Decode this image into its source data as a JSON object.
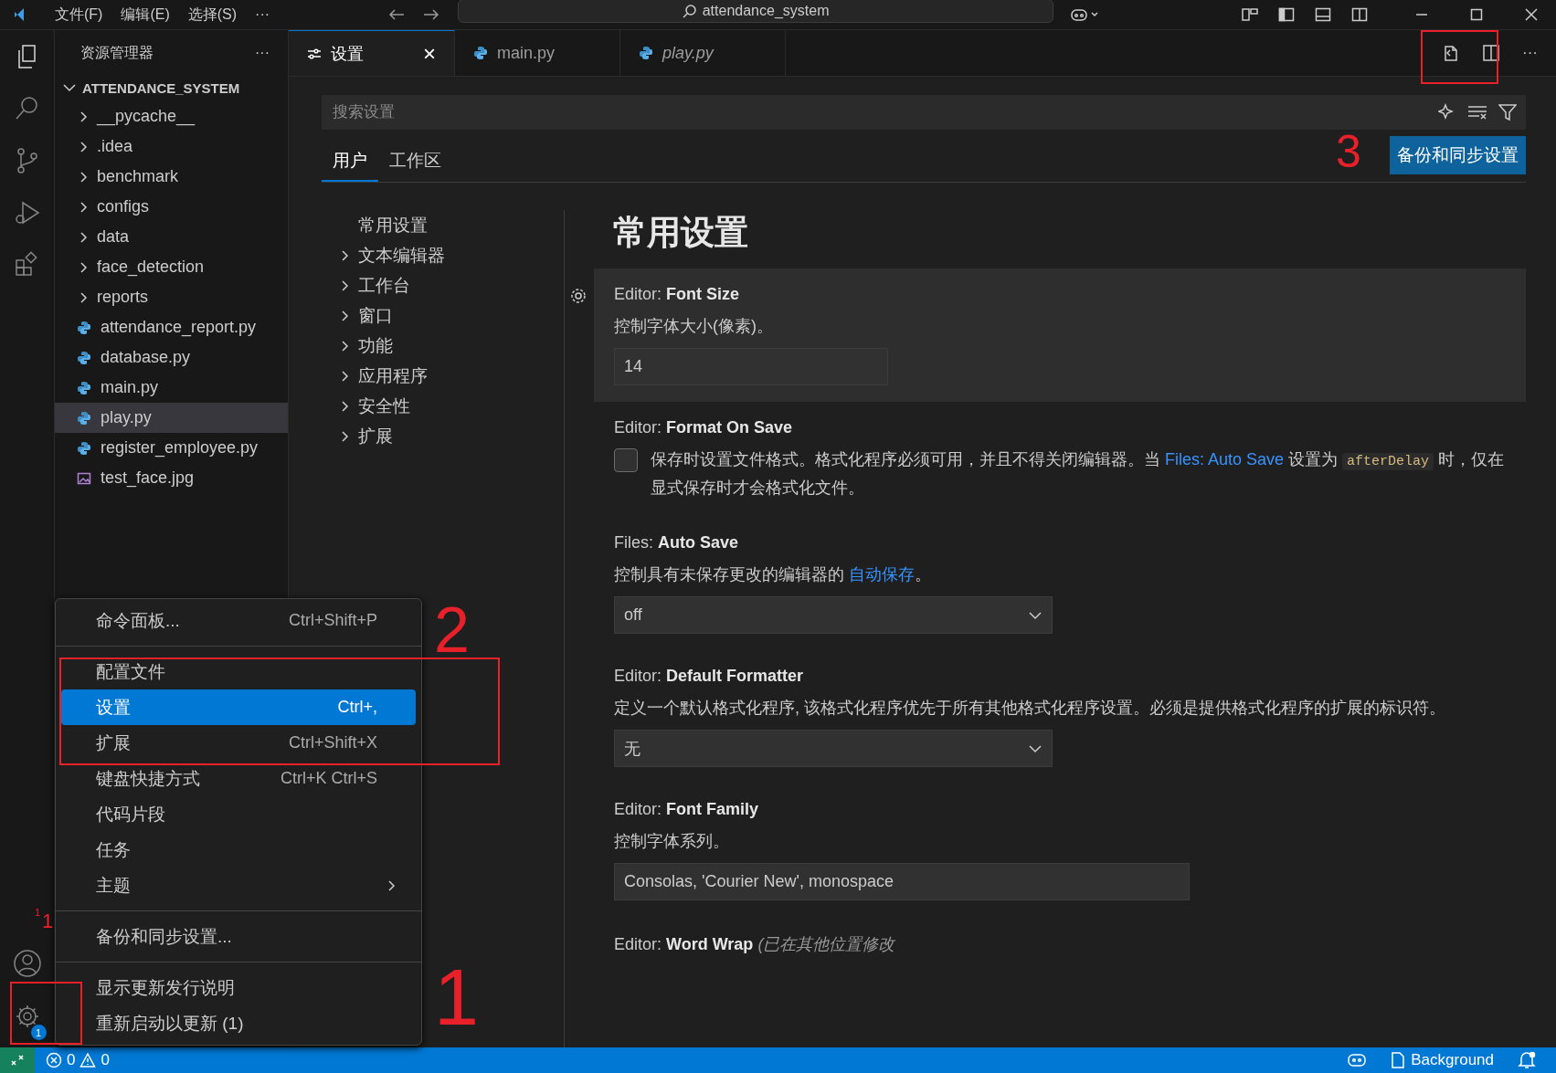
{
  "title_bar": {
    "menus": [
      "文件(F)",
      "编辑(E)",
      "选择(S)",
      "···"
    ],
    "search": "attendance_system"
  },
  "activity_bar": {
    "items": [
      {
        "selected": true
      },
      {
        "selected": false
      },
      {
        "selected": false
      },
      {
        "selected": false
      },
      {
        "selected": false
      }
    ],
    "manage_badge": "1"
  },
  "sidebar": {
    "title": "资源管理器",
    "more": "···",
    "folder": {
      "name": "ATTENDANCE_SYSTEM",
      "expanded": true,
      "children": [
        {
          "name": "__pycache__",
          "kind": "folder",
          "expanded": false,
          "selected": false
        },
        {
          "name": ".idea",
          "kind": "folder",
          "expanded": false,
          "selected": false
        },
        {
          "name": "benchmark",
          "kind": "folder",
          "expanded": false,
          "selected": false
        },
        {
          "name": "configs",
          "kind": "folder",
          "expanded": false,
          "selected": false
        },
        {
          "name": "data",
          "kind": "folder",
          "expanded": false,
          "selected": false
        },
        {
          "name": "face_detection",
          "kind": "folder",
          "expanded": false,
          "selected": false
        },
        {
          "name": "reports",
          "kind": "folder",
          "expanded": false,
          "selected": false
        },
        {
          "name": "attendance_report.py",
          "kind": "python",
          "selected": false
        },
        {
          "name": "database.py",
          "kind": "python",
          "selected": false
        },
        {
          "name": "main.py",
          "kind": "python",
          "selected": false
        },
        {
          "name": "play.py",
          "kind": "python",
          "selected": true
        },
        {
          "name": "register_employee.py",
          "kind": "python",
          "selected": false
        },
        {
          "name": "test_face.jpg",
          "kind": "image",
          "selected": false
        }
      ]
    }
  },
  "editor_actions": {
    "more": "···"
  },
  "tabs": [
    {
      "label": "设置",
      "kind": "settings",
      "selected": true,
      "preview": false,
      "close": "×"
    },
    {
      "label": "main.py",
      "kind": "python",
      "selected": false,
      "preview": false
    },
    {
      "label": "play.py",
      "kind": "python",
      "selected": false,
      "preview": true
    }
  ],
  "settings": {
    "search_placeholder": "搜索设置",
    "scopes": [
      {
        "label": "用户",
        "selected": true
      },
      {
        "label": "工作区",
        "selected": false
      }
    ],
    "sync_button": "备份和同步设置",
    "toc": [
      {
        "label": "常用设置",
        "expandable": false
      },
      {
        "label": "文本编辑器",
        "expandable": true
      },
      {
        "label": "工作台",
        "expandable": true
      },
      {
        "label": "窗口",
        "expandable": true
      },
      {
        "label": "功能",
        "expandable": true
      },
      {
        "label": "应用程序",
        "expandable": true
      },
      {
        "label": "安全性",
        "expandable": true
      },
      {
        "label": "扩展",
        "expandable": true
      }
    ],
    "heading": "常用设置",
    "items": [
      {
        "kind": "number",
        "category": "Editor: ",
        "title": "Font Size",
        "focused": true,
        "description": [
          {
            "kind": "text",
            "text": "控制字体大小(像素)。"
          }
        ],
        "value": "14"
      },
      {
        "kind": "checkbox",
        "category": "Editor: ",
        "title": "Format On Save",
        "focused": false,
        "checked": false,
        "description": [
          {
            "kind": "text",
            "text": "保存时设置文件格式。格式化程序必须可用，并且不得关闭编辑器。当 "
          },
          {
            "kind": "link",
            "text": "Files: Auto Save"
          },
          {
            "kind": "text",
            "text": " 设置为 "
          },
          {
            "kind": "code",
            "text": "afterDelay"
          },
          {
            "kind": "text",
            "text": " 时，仅在显式保存时才会格式化文件。"
          }
        ]
      },
      {
        "kind": "select",
        "category": "Files: ",
        "title": "Auto Save",
        "focused": false,
        "description": [
          {
            "kind": "text",
            "text": "控制具有未保存更改的编辑器的 "
          },
          {
            "kind": "link",
            "text": "自动保存"
          },
          {
            "kind": "text",
            "text": "。"
          }
        ],
        "value": "off"
      },
      {
        "kind": "select",
        "category": "Editor: ",
        "title": "Default Formatter",
        "focused": false,
        "description": [
          {
            "kind": "text",
            "text": "定义一个默认格式化程序, 该格式化程序优先于所有其他格式化程序设置。必须是提供格式化程序的扩展的标识符。"
          }
        ],
        "value": "无"
      },
      {
        "kind": "text",
        "category": "Editor: ",
        "title": "Font Family",
        "focused": false,
        "description": [
          {
            "kind": "text",
            "text": "控制字体系列。"
          }
        ],
        "value": "Consolas, 'Courier New', monospace"
      },
      {
        "kind": "header",
        "category": "Editor: ",
        "title": "Word Wrap",
        "focused": false,
        "note": "(已在其他位置修改"
      }
    ]
  },
  "menu": {
    "groups": [
      [
        {
          "label": "命令面板...",
          "shortcut": "Ctrl+Shift+P",
          "selected": false,
          "submenu": false
        }
      ],
      [
        {
          "label": "配置文件",
          "selected": false,
          "submenu": false
        },
        {
          "label": "设置",
          "shortcut": "Ctrl+,",
          "selected": true,
          "submenu": false
        },
        {
          "label": "扩展",
          "shortcut": "Ctrl+Shift+X",
          "selected": false,
          "submenu": false
        },
        {
          "label": "键盘快捷方式",
          "shortcut": "Ctrl+K Ctrl+S",
          "selected": false,
          "submenu": false
        },
        {
          "label": "代码片段",
          "selected": false,
          "submenu": false
        },
        {
          "label": "任务",
          "selected": false,
          "submenu": false
        },
        {
          "label": "主题",
          "selected": false,
          "submenu": true
        }
      ],
      [
        {
          "label": "备份和同步设置...",
          "selected": false,
          "submenu": false
        }
      ],
      [
        {
          "label": "显示更新发行说明",
          "selected": false,
          "submenu": false
        },
        {
          "label": "重新启动以更新 (1)",
          "selected": false,
          "submenu": false
        }
      ]
    ]
  },
  "status_bar": {
    "errors": "0",
    "warnings": "0",
    "background": "Background"
  },
  "annotations": [
    {
      "kind": "box"
    },
    {
      "kind": "number",
      "label": "3"
    },
    {
      "kind": "box"
    },
    {
      "kind": "number",
      "label": "2"
    },
    {
      "kind": "box"
    },
    {
      "kind": "number",
      "label": "1"
    },
    {
      "kind": "number",
      "label": "1"
    },
    {
      "kind": "number",
      "label": "1"
    }
  ]
}
